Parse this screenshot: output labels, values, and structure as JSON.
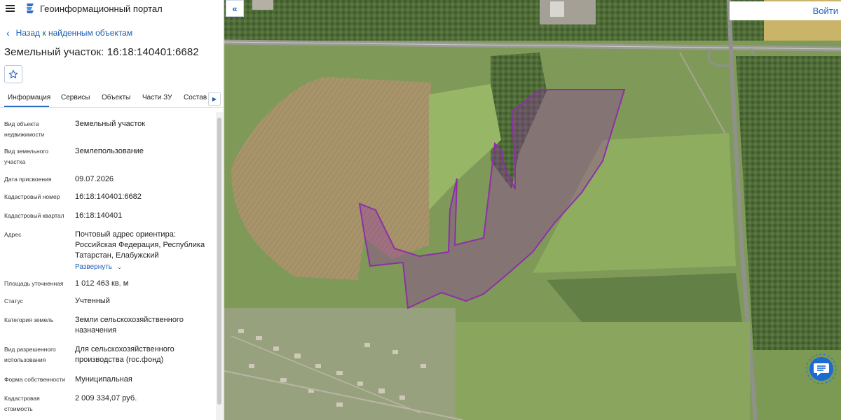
{
  "header": {
    "app_title": "Геоинформационный портал",
    "logo_icon": "portal-logo-icon",
    "menu_icon": "hamburger-menu-icon"
  },
  "back_link": {
    "label": "Назад к найденным объектам"
  },
  "object": {
    "title": "Земельный участок: 16:18:140401:6682"
  },
  "tabs": [
    {
      "label": "Информация",
      "active": true
    },
    {
      "label": "Сервисы"
    },
    {
      "label": "Объекты"
    },
    {
      "label": "Части ЗУ"
    },
    {
      "label": "Состав"
    }
  ],
  "info": [
    {
      "label": "Вид объекта недвижимости",
      "value": "Земельный участок"
    },
    {
      "label": "Вид земельного участка",
      "value": "Землепользование"
    },
    {
      "label": "Дата присвоения",
      "value": "09.07.2026"
    },
    {
      "label": "Кадастровый номер",
      "value": "16:18:140401:6682"
    },
    {
      "label": "Кадастровый квартал",
      "value": "16:18:140401"
    },
    {
      "label": "Адрес",
      "value": "Почтовый адрес ориентира: Российская Федерация, Республика Татарстан, Елабужский",
      "expand": "Развернуть"
    },
    {
      "label": "Площадь уточненная",
      "value": "1 012 463 кв. м"
    },
    {
      "label": "Статус",
      "value": "Учтенный"
    },
    {
      "label": "Категория земель",
      "value": "Земли сельскохозяйственного назначения"
    },
    {
      "label": "Вид разрешенного использования",
      "value": "Для сельскохозяйственного производства (гос.фонд)"
    },
    {
      "label": "Форма собственности",
      "value": "Муниципальная"
    },
    {
      "label": "Кадастровая стоимость",
      "value": "2 009 334,07 руб."
    }
  ],
  "map": {
    "login_label": "Войти",
    "parcel_color": "#8e2fa8",
    "accent": "#1d5fb3"
  }
}
